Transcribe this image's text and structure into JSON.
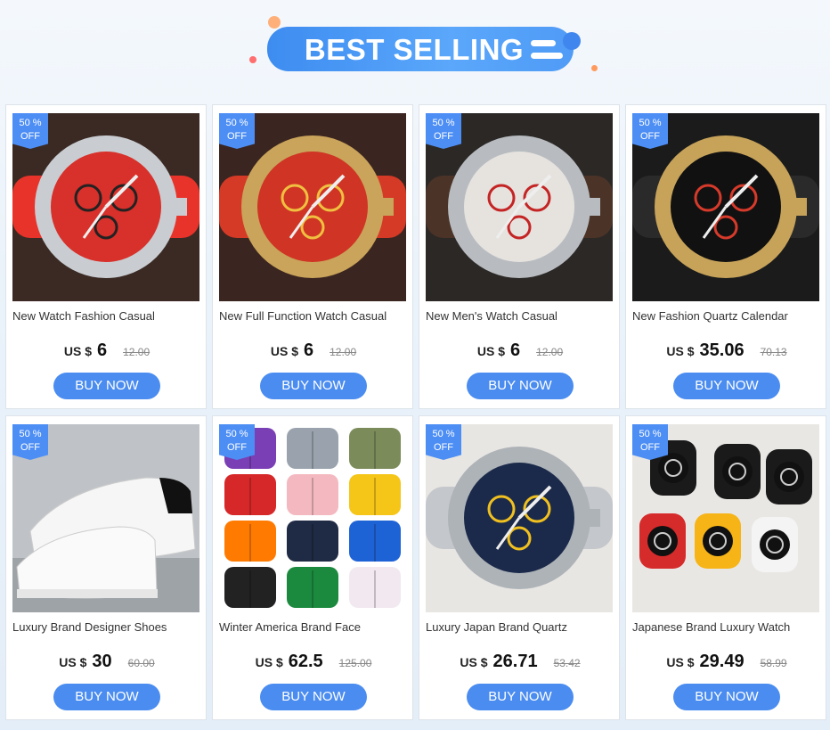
{
  "banner": {
    "title": "BEST SELLING"
  },
  "currency_label": "US $",
  "buy_label": "BUY NOW",
  "colors": {
    "accent": "#4a8cf0",
    "badge": "#4d8ef5"
  },
  "products": [
    {
      "title": "New Watch Fashion Casual",
      "price": "6",
      "old_price": "12.00",
      "discount": "50 %",
      "off": "OFF",
      "image": "red-chronograph-watch"
    },
    {
      "title": "New Full Function Watch Casual",
      "price": "6",
      "old_price": "12.00",
      "discount": "50 %",
      "off": "OFF",
      "image": "gold-red-watch"
    },
    {
      "title": "New Men's Watch Casual",
      "price": "6",
      "old_price": "12.00",
      "discount": "50 %",
      "off": "OFF",
      "image": "silver-red-watch"
    },
    {
      "title": "New Fashion Quartz Calendar",
      "price": "35.06",
      "old_price": "70.13",
      "discount": "50 %",
      "off": "OFF",
      "image": "black-gold-watch"
    },
    {
      "title": "Luxury Brand Designer Shoes",
      "price": "30",
      "old_price": "60.00",
      "discount": "50 %",
      "off": "OFF",
      "image": "white-sneakers"
    },
    {
      "title": "Winter America Brand Face",
      "price": "62.5",
      "old_price": "125.00",
      "discount": "50 %",
      "off": "OFF",
      "image": "puffer-jackets-grid"
    },
    {
      "title": "Luxury Japan Brand Quartz",
      "price": "26.71",
      "old_price": "53.42",
      "discount": "50 %",
      "off": "OFF",
      "image": "blue-steel-watch"
    },
    {
      "title": "Japanese Brand Luxury Watch",
      "price": "29.49",
      "old_price": "58.99",
      "discount": "50 %",
      "off": "OFF",
      "image": "sport-digital-watches"
    }
  ]
}
